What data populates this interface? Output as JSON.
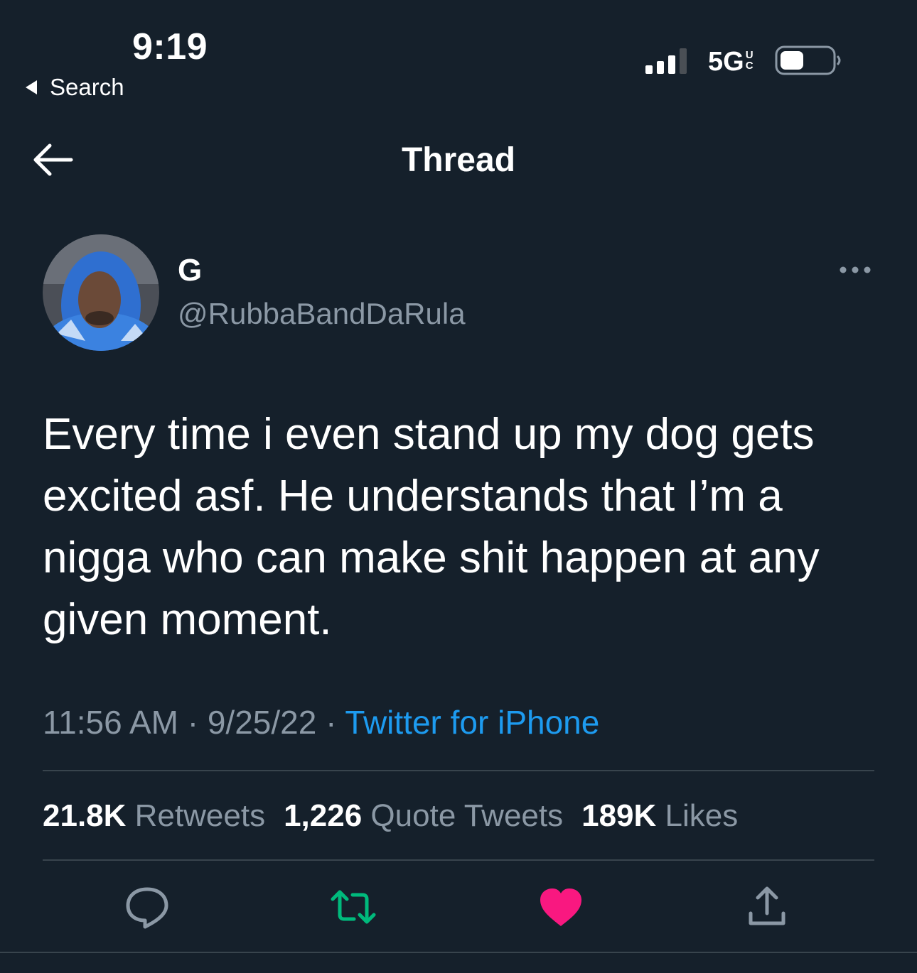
{
  "status_bar": {
    "time": "9:19",
    "back_label": "Search",
    "network": "5G",
    "network_sup_top": "U",
    "network_sup_bottom": "C"
  },
  "header": {
    "title": "Thread"
  },
  "tweet": {
    "display_name": "G",
    "handle": "@RubbaBandDaRula",
    "text": "Every time i even stand up my dog gets excited asf. He understands that I’m a nigga who can make shit happen at any given moment.",
    "time": "11:56 AM",
    "sep1": " · ",
    "date": "9/25/22",
    "sep2": " · ",
    "source": "Twitter for iPhone"
  },
  "stats": {
    "retweets_count": "21.8K",
    "retweets_label": "Retweets",
    "quotes_count": "1,226",
    "quotes_label": "Quote Tweets",
    "likes_count": "189K",
    "likes_label": "Likes"
  },
  "colors": {
    "background": "#15202b",
    "secondary_text": "#8b98a5",
    "link": "#1d9bf0",
    "retweet_active": "#00ba7c",
    "like_active": "#f91880",
    "divider": "#38444d"
  },
  "icons": {
    "reply": "reply-icon",
    "retweet": "retweet-icon",
    "like": "like-icon",
    "share": "share-icon"
  }
}
